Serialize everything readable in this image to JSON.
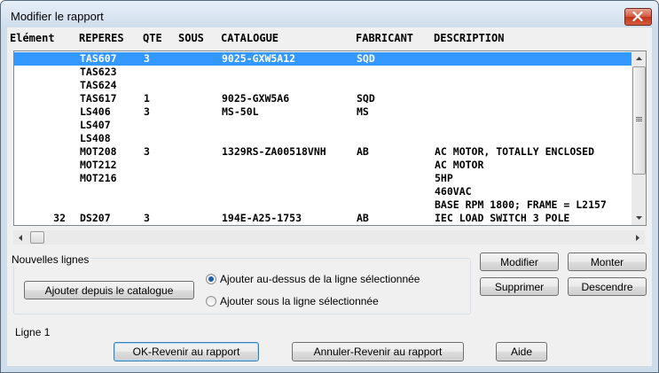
{
  "window": {
    "title": "Modifier le rapport"
  },
  "columns": [
    "Elément",
    "REPERES",
    "QTE",
    "SOUS",
    "CATALOGUE",
    "FABRICANT",
    "DESCRIPTION"
  ],
  "rows": [
    {
      "elem": "",
      "rep": "TAS607",
      "qte": "3",
      "sous": "",
      "cat": "9025-GXW5A12",
      "fab": "SQD",
      "desc": "",
      "selected": true
    },
    {
      "elem": "",
      "rep": "TAS623",
      "qte": "",
      "sous": "",
      "cat": "",
      "fab": "",
      "desc": ""
    },
    {
      "elem": "",
      "rep": "TAS624",
      "qte": "",
      "sous": "",
      "cat": "",
      "fab": "",
      "desc": ""
    },
    {
      "elem": "",
      "rep": "TAS617",
      "qte": "1",
      "sous": "",
      "cat": "9025-GXW5A6",
      "fab": "SQD",
      "desc": ""
    },
    {
      "elem": "",
      "rep": "LS406",
      "qte": "3",
      "sous": "",
      "cat": "MS-50L",
      "fab": "MS",
      "desc": ""
    },
    {
      "elem": "",
      "rep": "LS407",
      "qte": "",
      "sous": "",
      "cat": "",
      "fab": "",
      "desc": ""
    },
    {
      "elem": "",
      "rep": "LS408",
      "qte": "",
      "sous": "",
      "cat": "",
      "fab": "",
      "desc": ""
    },
    {
      "elem": "",
      "rep": "MOT208",
      "qte": "3",
      "sous": "",
      "cat": "1329RS-ZA00518VNH",
      "fab": "AB",
      "desc": "AC MOTOR, TOTALLY ENCLOSED"
    },
    {
      "elem": "",
      "rep": "MOT212",
      "qte": "",
      "sous": "",
      "cat": "",
      "fab": "",
      "desc": "AC MOTOR"
    },
    {
      "elem": "",
      "rep": "MOT216",
      "qte": "",
      "sous": "",
      "cat": "",
      "fab": "",
      "desc": "5HP"
    },
    {
      "elem": "",
      "rep": "",
      "qte": "",
      "sous": "",
      "cat": "",
      "fab": "",
      "desc": "460VAC"
    },
    {
      "elem": "",
      "rep": "",
      "qte": "",
      "sous": "",
      "cat": "",
      "fab": "",
      "desc": "BASE RPM 1800; FRAME = L2157"
    },
    {
      "elem": "32",
      "rep": "DS207",
      "qte": "3",
      "sous": "",
      "cat": "194E-A25-1753",
      "fab": "AB",
      "desc": "IEC LOAD SWITCH 3 POLE"
    }
  ],
  "group": {
    "label": "Nouvelles lignes",
    "add_catalog": "Ajouter depuis le catalogue",
    "radio_above": "Ajouter au-dessus de la ligne sélectionnée",
    "radio_below": "Ajouter sous la ligne sélectionnée",
    "selected_option": "above"
  },
  "side_buttons": {
    "modify": "Modifier",
    "up": "Monter",
    "delete": "Supprimer",
    "down": "Descendre"
  },
  "status": "Ligne 1",
  "bottom_buttons": {
    "ok": "OK-Revenir au rapport",
    "cancel": "Annuler-Revenir au rapport",
    "help": "Aide"
  },
  "icons": {
    "close": "close-icon",
    "up": "arrow-up-icon",
    "down": "arrow-down-icon",
    "left": "arrow-left-icon",
    "right": "arrow-right-icon"
  },
  "colors": {
    "selection": "#3399ff",
    "close_button": "#c2341a"
  }
}
